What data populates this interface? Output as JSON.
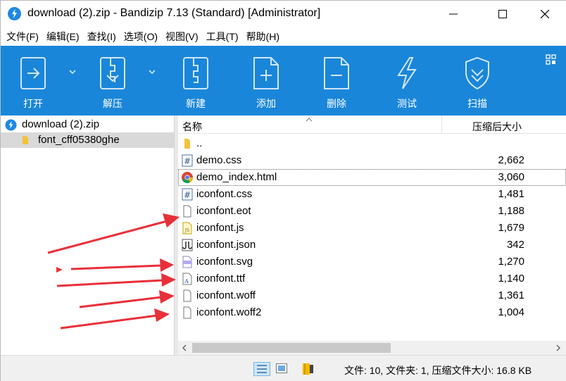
{
  "window": {
    "title": "download (2).zip - Bandizip 7.13 (Standard) [Administrator]"
  },
  "menu": [
    "文件(F)",
    "编辑(E)",
    "查找(I)",
    "选项(O)",
    "视图(V)",
    "工具(T)",
    "帮助(H)"
  ],
  "toolbar": {
    "open": "打开",
    "extract": "解压",
    "new": "新建",
    "add": "添加",
    "delete": "删除",
    "test": "测试",
    "scan": "扫描"
  },
  "tree": {
    "archive": "download (2).zip",
    "folder": "font_cff05380ghe"
  },
  "columns": {
    "name": "名称",
    "compressed_size": "压缩后大小"
  },
  "files": [
    {
      "name": "..",
      "size": "",
      "icon": "folder-icon"
    },
    {
      "name": "demo.css",
      "size": "2,662",
      "icon": "css-file-icon"
    },
    {
      "name": "demo_index.html",
      "size": "3,060",
      "icon": "chrome-html-icon"
    },
    {
      "name": "iconfont.css",
      "size": "1,481",
      "icon": "css-file-icon"
    },
    {
      "name": "iconfont.eot",
      "size": "1,188",
      "icon": "blank-file-icon"
    },
    {
      "name": "iconfont.js",
      "size": "1,679",
      "icon": "js-file-icon"
    },
    {
      "name": "iconfont.json",
      "size": "342",
      "icon": "json-file-icon"
    },
    {
      "name": "iconfont.svg",
      "size": "1,270",
      "icon": "svg-file-icon"
    },
    {
      "name": "iconfont.ttf",
      "size": "1,140",
      "icon": "font-file-icon"
    },
    {
      "name": "iconfont.woff",
      "size": "1,361",
      "icon": "blank-file-icon"
    },
    {
      "name": "iconfont.woff2",
      "size": "1,004",
      "icon": "blank-file-icon"
    }
  ],
  "status": {
    "text": "文件: 10, 文件夹: 1, 压缩文件大小: 16.8 KB"
  },
  "colors": {
    "toolbar": "#1a86d9",
    "annotation_arrow": "#e8303a"
  }
}
